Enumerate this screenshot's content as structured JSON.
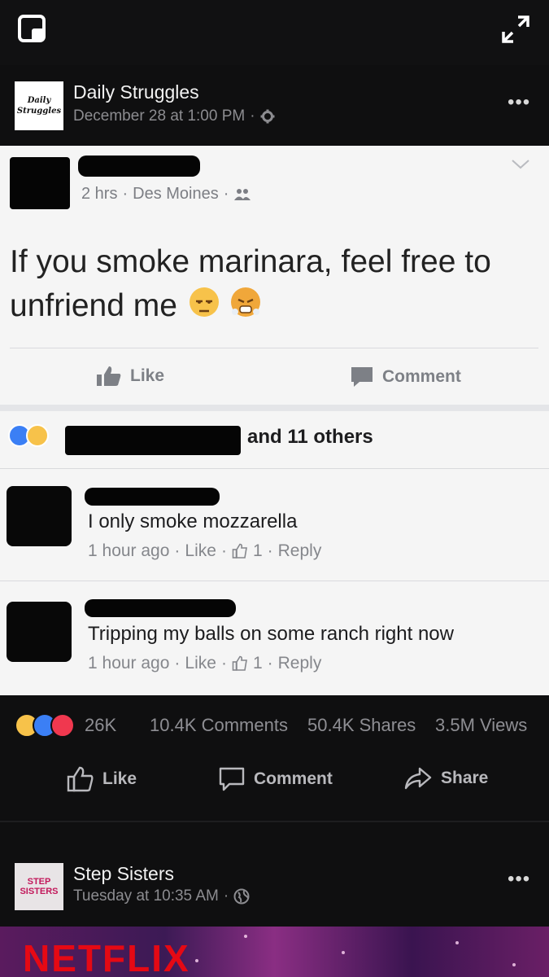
{
  "post": {
    "page_name": "Daily Struggles",
    "avatar_line1": "Daily",
    "avatar_line2": "Struggles",
    "date": "December 28 at 1:00 PM",
    "dot": "·"
  },
  "screenshot": {
    "meta_time": "2 hrs",
    "meta_place": "Des Moines",
    "dot": "·",
    "status": "If you smoke marinara, feel free to unfriend me",
    "like_label": "Like",
    "comment_label": "Comment",
    "others_text": "and 11 others",
    "comments": [
      {
        "text": "I only smoke mozzarella",
        "time": "1 hour ago",
        "like": "Like",
        "count": "1",
        "reply": "Reply"
      },
      {
        "text": "Tripping my balls on some ranch right now",
        "time": "1 hour ago",
        "like": "Like",
        "count": "1",
        "reply": "Reply"
      }
    ]
  },
  "stats": {
    "reactions": "26K",
    "comments": "10.4K Comments",
    "shares": "50.4K Shares",
    "views": "3.5M Views"
  },
  "actions": {
    "like": "Like",
    "comment": "Comment",
    "share": "Share"
  },
  "post2": {
    "page_name": "Step Sisters",
    "avatar_line1": "STEP",
    "avatar_line2": "SISTERS",
    "date": "Tuesday at 10:35 AM",
    "dot": "·",
    "banner_text": "NETFLIX"
  },
  "colors": {
    "background": "#0f0f10",
    "like_blue": "#3b7ff5",
    "love_red": "#f0384f",
    "haha_yellow": "#f7c24a"
  },
  "icons": [
    "window-icon",
    "expand-icon",
    "more-icon",
    "gear-icon",
    "chevron-down-icon",
    "friends-icon",
    "thumbs-up-icon",
    "comment-icon",
    "share-icon",
    "globe-icon"
  ]
}
